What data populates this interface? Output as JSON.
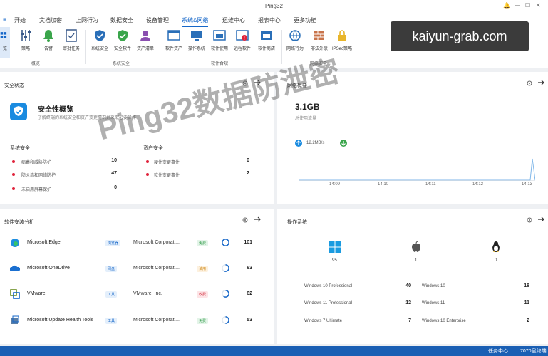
{
  "window": {
    "title": "Ping32"
  },
  "menu": [
    "开始",
    "文档加密",
    "上网行为",
    "数据安全",
    "设备管理",
    "系统&网络",
    "运维中心",
    "报表中心",
    "更多功能"
  ],
  "ribbon": {
    "first_label": "览",
    "buttons": [
      "策略",
      "告警",
      "审批任务",
      "系统安全",
      "安全软件",
      "资产清单",
      "软件资产",
      "操作系统",
      "软件使用",
      "远程软件",
      "软件商店",
      "网络行为",
      "非法外联",
      "IPSec策略"
    ],
    "ipsec_badge": "IPSec",
    "groups": [
      "概览",
      "系统安全",
      "软件合规",
      "网络安全"
    ]
  },
  "security": {
    "title": "安全状态",
    "heading": "安全性概览",
    "desc": "了解终端的系统安全和资产变更情况并采取必要操作",
    "left_title": "系统安全",
    "left_items": [
      {
        "label": "病毒和威胁防护",
        "value": "10"
      },
      {
        "label": "防火墙和网络防护",
        "value": "47"
      },
      {
        "label": "未启用屏幕保护",
        "value": "0"
      }
    ],
    "right_title": "资产安全",
    "right_items": [
      {
        "label": "硬件变更事件",
        "value": "0"
      },
      {
        "label": "软件变更事件",
        "value": "2"
      }
    ]
  },
  "network": {
    "title": "网络概要",
    "total": "3.1GB",
    "total_label": "总使用流量",
    "upload": "12.2MB/s",
    "times": [
      "14:09",
      "14:10",
      "14:11",
      "14:12",
      "14:13"
    ]
  },
  "software": {
    "title": "软件安装分析",
    "rows": [
      {
        "name": "Microsoft Edge",
        "tag": "浏览器",
        "vendor": "Microsoft Corporati...",
        "status": "免费",
        "count": "101",
        "fill": 1.0
      },
      {
        "name": "Microsoft OneDrive",
        "tag": "网盘",
        "vendor": "Microsoft Corporati...",
        "status": "试用",
        "count": "63",
        "fill": 0.6
      },
      {
        "name": "VMware",
        "tag": "工具",
        "vendor": "VMware, Inc.",
        "status": "收费",
        "count": "62",
        "fill": 0.6
      },
      {
        "name": "Microsoft Update Health Tools",
        "tag": "工具",
        "vendor": "Microsoft Corporati...",
        "status": "免费",
        "count": "53",
        "fill": 0.5
      }
    ]
  },
  "os": {
    "title": "操作系统",
    "counts": [
      "95",
      "1",
      "0"
    ],
    "versions": [
      {
        "name": "Windows 10 Professional",
        "value": "40"
      },
      {
        "name": "Windows 10",
        "value": "18"
      },
      {
        "name": "Windows 11 Professional",
        "value": "12"
      },
      {
        "name": "Windows 11",
        "value": "11"
      },
      {
        "name": "Windows 7 Ultimate",
        "value": "7"
      },
      {
        "name": "Windows 10 Enterprise",
        "value": "2"
      }
    ]
  },
  "statusbar": {
    "task": "任务中心",
    "clients": "7070皇终端"
  },
  "watermark": "Ping32数据防泄密",
  "brand": "kaiyun-grab.com",
  "colors": {
    "accent": "#1667c9",
    "alert": "#e0243c",
    "status_bar": "#1a5fb4"
  }
}
